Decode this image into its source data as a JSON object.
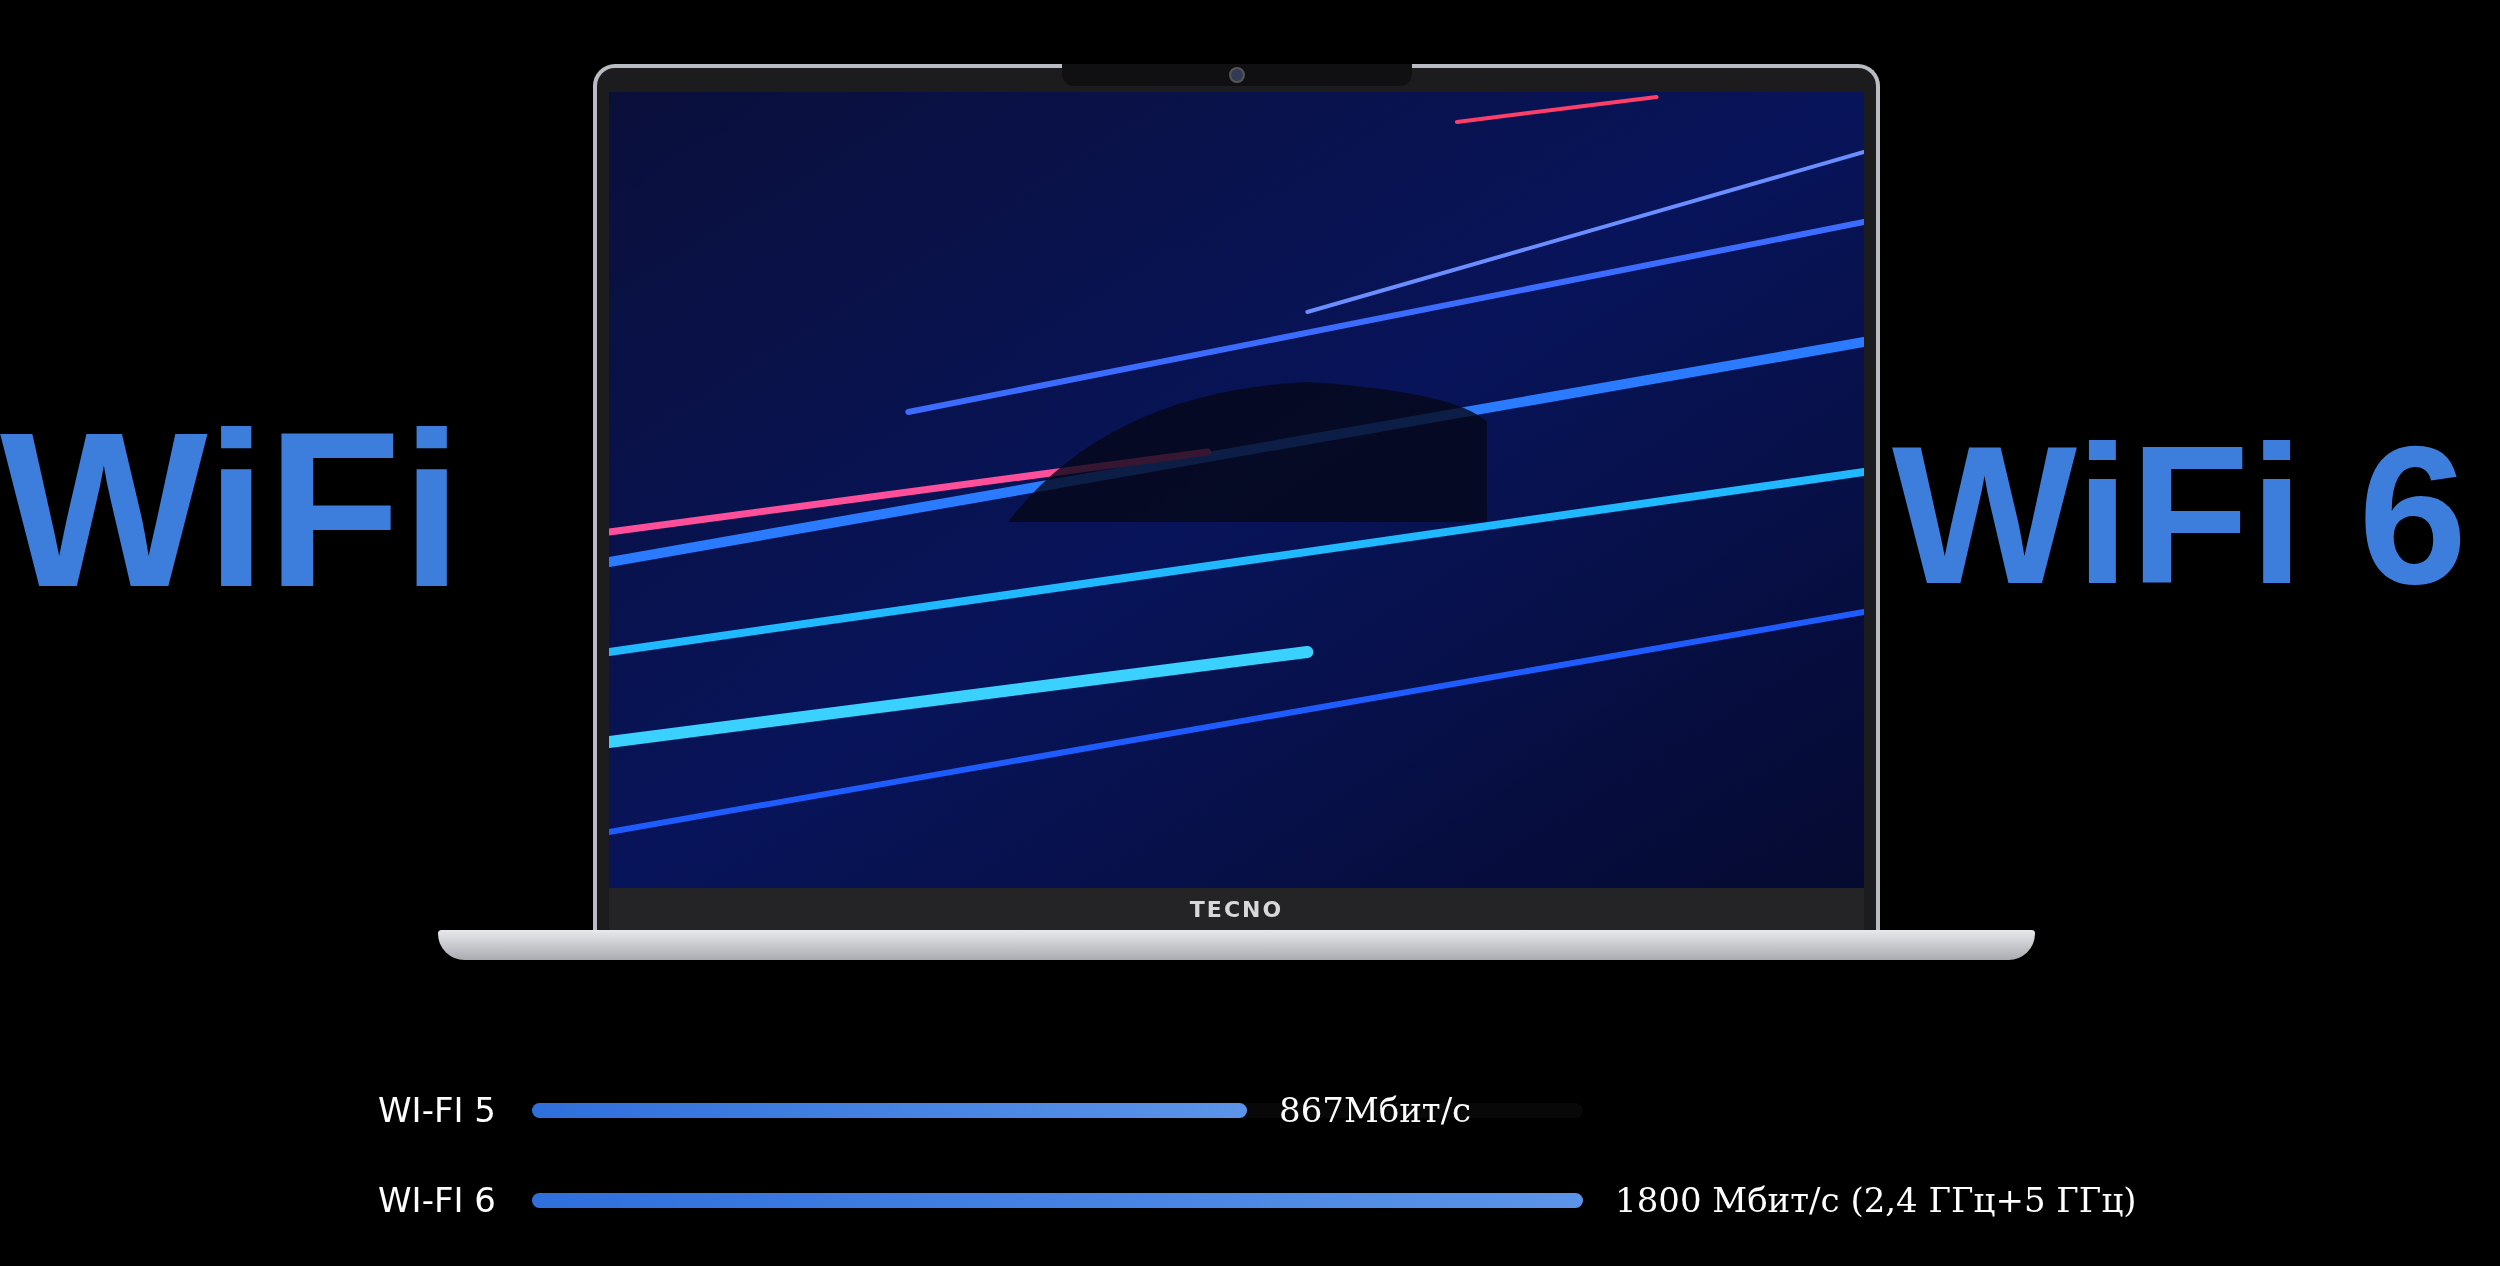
{
  "headlines": [
    "WiFi",
    "WiFi 6"
  ],
  "laptop": {
    "logo": "TECNO"
  },
  "comparison": [
    {
      "label": "WI-FI 5",
      "level": 0.68,
      "reading": "867Мбит/с"
    },
    {
      "label": "WI-FI 6",
      "level": 1,
      "reading": "1800 Мбит/с (2,4 ГГц+5 ГГц)"
    }
  ]
}
